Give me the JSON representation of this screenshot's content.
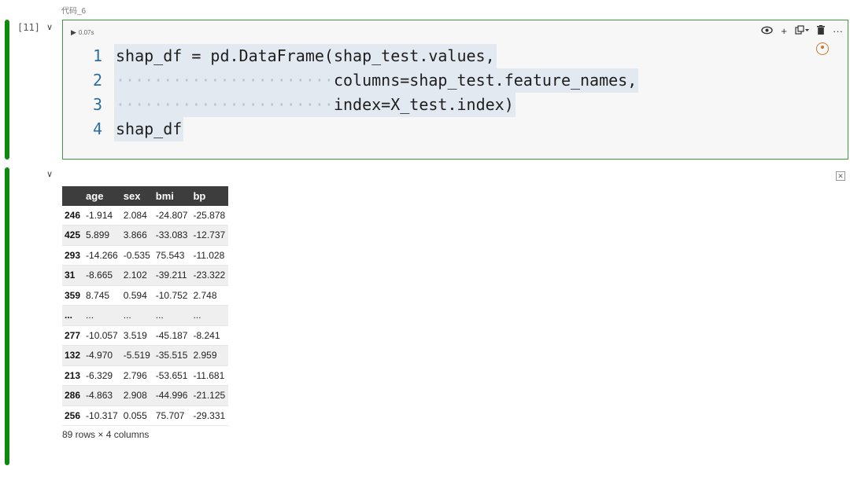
{
  "cell": {
    "title": "代码_6",
    "execution_count": "[11]",
    "run_time": "0.07s",
    "toolbar_icons": [
      "eye-icon",
      "plus-icon",
      "copy-icon",
      "trash-icon",
      "more-icon"
    ],
    "code_lines": [
      {
        "num": "1",
        "indent": "",
        "text": "shap_df = pd.DataFrame(shap_test.values,"
      },
      {
        "num": "2",
        "indent": "·······················",
        "text": "columns=shap_test.feature_names,"
      },
      {
        "num": "3",
        "indent": "·······················",
        "text": "index=X_test.index)"
      },
      {
        "num": "4",
        "indent": "",
        "text": "shap_df"
      }
    ]
  },
  "output": {
    "columns": [
      "",
      "age",
      "sex",
      "bmi",
      "bp"
    ],
    "rows": [
      [
        "246",
        "-1.914",
        "2.084",
        "-24.807",
        "-25.878"
      ],
      [
        "425",
        "5.899",
        "3.866",
        "-33.083",
        "-12.737"
      ],
      [
        "293",
        "-14.266",
        "-0.535",
        "75.543",
        "-11.028"
      ],
      [
        "31",
        "-8.665",
        "2.102",
        "-39.211",
        "-23.322"
      ],
      [
        "359",
        "8.745",
        "0.594",
        "-10.752",
        "2.748"
      ],
      [
        "...",
        "...",
        "...",
        "...",
        "..."
      ],
      [
        "277",
        "-10.057",
        "3.519",
        "-45.187",
        "-8.241"
      ],
      [
        "132",
        "-4.970",
        "-5.519",
        "-35.515",
        "2.959"
      ],
      [
        "213",
        "-6.329",
        "2.796",
        "-53.651",
        "-11.681"
      ],
      [
        "286",
        "-4.863",
        "2.908",
        "-44.996",
        "-21.125"
      ],
      [
        "256",
        "-10.317",
        "0.055",
        "75.707",
        "-29.331"
      ]
    ],
    "shape": "89 rows × 4 columns"
  }
}
